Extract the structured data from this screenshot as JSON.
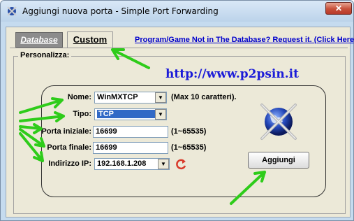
{
  "window": {
    "title": "Aggiungi nuova porta - Simple Port Forwarding",
    "close_label": "✕"
  },
  "tabs": {
    "database": "Database",
    "custom": "Custom"
  },
  "request_link": "Program/Game Not in The Database? Request it. (Click Here)",
  "group_label": "Personalizza:",
  "url": "http://www.p2psin.it",
  "form": {
    "name_label": "Nome:",
    "name_value": "WinMXTCP",
    "name_hint": "(Max 10 caratteri).",
    "type_label": "Tipo:",
    "type_value": "TCP",
    "port_start_label": "Porta iniziale:",
    "port_start_value": "16699",
    "port_start_hint": "(1~65535)",
    "port_end_label": "Porta finale:",
    "port_end_value": "16699",
    "port_end_hint": "(1~65535)",
    "ip_label": "Indirizzo IP:",
    "ip_value": "192.168.1.208"
  },
  "add_button": "Aggiungi",
  "icons": {
    "app": "app-icon",
    "refresh": "refresh-icon",
    "globe": "globe-icon",
    "dropdown": "chevron-down-icon"
  },
  "colors": {
    "arrow": "#2ecc1a",
    "url": "#1b1bd8",
    "selection": "#3169c6",
    "link": "#0000cc"
  }
}
